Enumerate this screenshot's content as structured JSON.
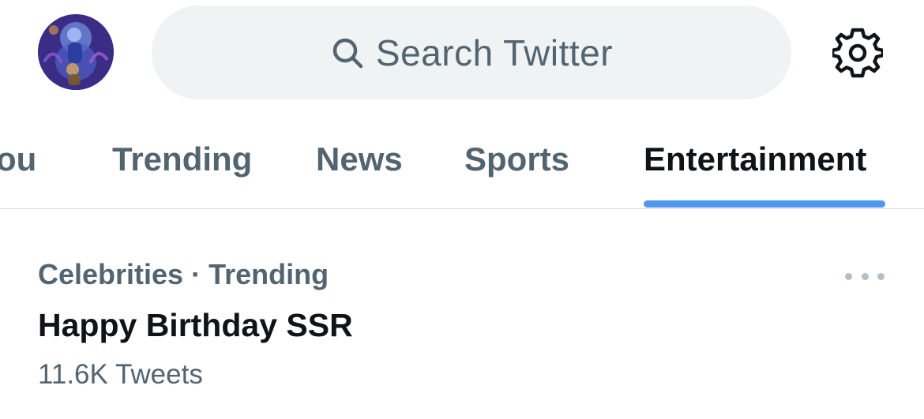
{
  "search": {
    "placeholder": "Search Twitter"
  },
  "tabs": [
    {
      "label": "ou",
      "active": false
    },
    {
      "label": "Trending",
      "active": false
    },
    {
      "label": "News",
      "active": false
    },
    {
      "label": "Sports",
      "active": false
    },
    {
      "label": "Entertainment",
      "active": true
    }
  ],
  "trend": {
    "category": "Celebrities · Trending",
    "title": "Happy Birthday SSR",
    "count": "11.6K Tweets"
  },
  "icons": {
    "search": "search-icon",
    "settings": "gear-icon",
    "more": "more-horizontal-icon"
  },
  "colors": {
    "accent": "#4f97ee",
    "text_primary": "#0f1419",
    "text_secondary": "#536471",
    "search_bg": "#eff3f4"
  }
}
